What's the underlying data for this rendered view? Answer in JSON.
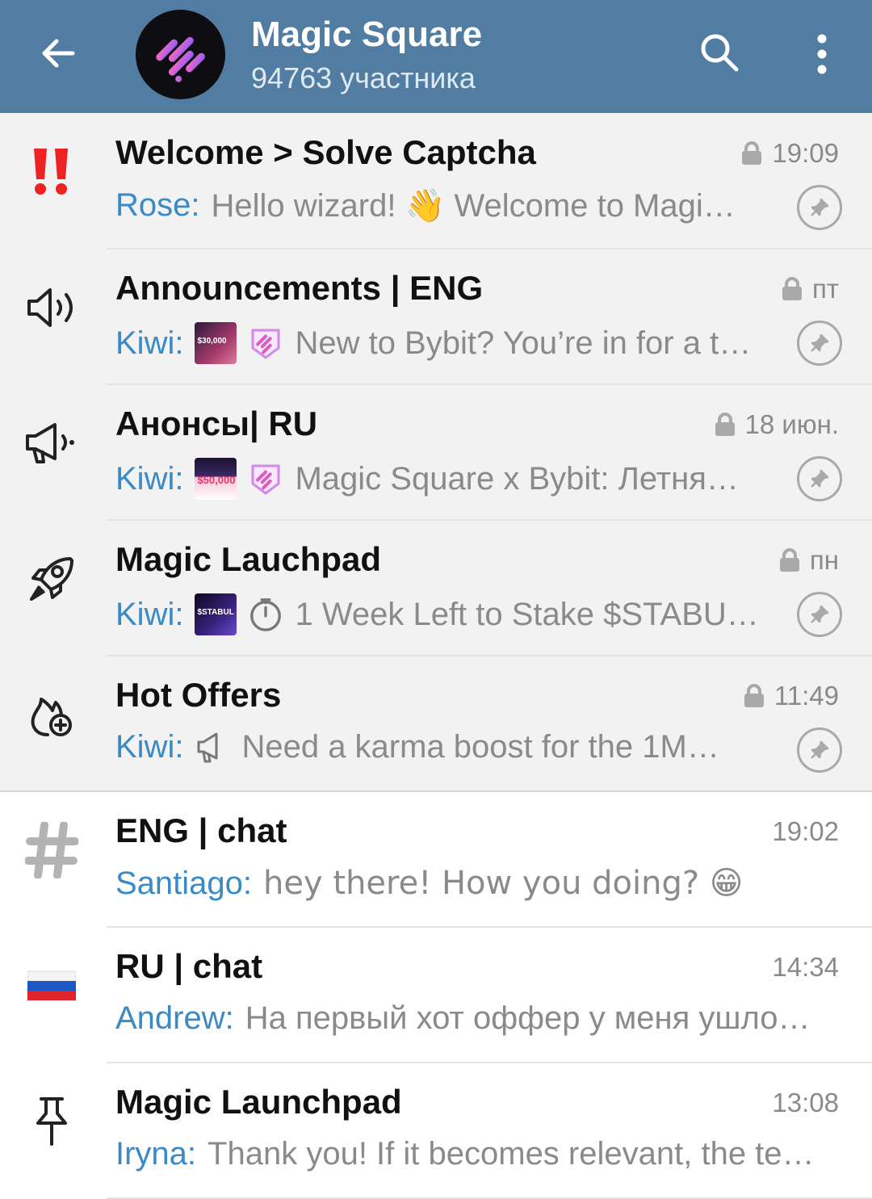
{
  "header": {
    "title": "Magic Square",
    "subtitle": "94763 участника",
    "icons": {
      "back": "back-arrow-icon",
      "search": "search-icon",
      "menu": "more-vertical-icon",
      "avatar": "magic-square-logo"
    },
    "background": "#517da2"
  },
  "topics": [
    {
      "title": "Welcome > Solve Captcha",
      "time": "19:09",
      "locked": true,
      "pinned": true,
      "icon": "double-exclamation-icon",
      "sender": "Rose:",
      "message": "Hello wizard! 👋 Welcome to Magi…"
    },
    {
      "title": "Announcements | ENG",
      "time": "пт",
      "locked": true,
      "pinned": true,
      "icon": "speaker-icon",
      "sender": "Kiwi:",
      "message": "New to Bybit? You’re in for a t…",
      "thumb_text": "$30,000"
    },
    {
      "title": "Анонсы| RU",
      "time": "18 июн.",
      "locked": true,
      "pinned": true,
      "icon": "megaphone-icon",
      "sender": "Kiwi:",
      "message": "Magic Square x Bybit: Летня…",
      "thumb_text": "$50,000"
    },
    {
      "title": "Magic Lauchpad",
      "time": "пн",
      "locked": true,
      "pinned": true,
      "icon": "rocket-icon",
      "sender": "Kiwi:",
      "message": "1 Week Left to Stake $STABU…",
      "thumb_text": "$STABUL"
    },
    {
      "title": "Hot Offers",
      "time": "11:49",
      "locked": true,
      "pinned": true,
      "icon": "flame-plus-icon",
      "sender": "Kiwi:",
      "message": "Need a karma boost for the 1M…"
    },
    {
      "title": "ENG | chat",
      "time": "19:02",
      "locked": false,
      "pinned": false,
      "icon": "hashtag-icon",
      "sender": "Santiago:",
      "message": "hey there! How you doing? 😁"
    },
    {
      "title": "RU | chat",
      "time": "14:34",
      "locked": false,
      "pinned": false,
      "icon": "russian-flag-icon",
      "sender": "Andrew:",
      "message": "На первый хот оффер у меня ушло…"
    },
    {
      "title": "Magic Launchpad",
      "time": "13:08",
      "locked": false,
      "pinned": false,
      "icon": "pushpin-icon",
      "sender": "Iryna:",
      "message": "Thank you! If it becomes relevant, the te…"
    }
  ],
  "colors": {
    "sender": "#3a8ac5",
    "pinned_bg": "#f2f2f2",
    "muted": "#8a8a8a"
  }
}
